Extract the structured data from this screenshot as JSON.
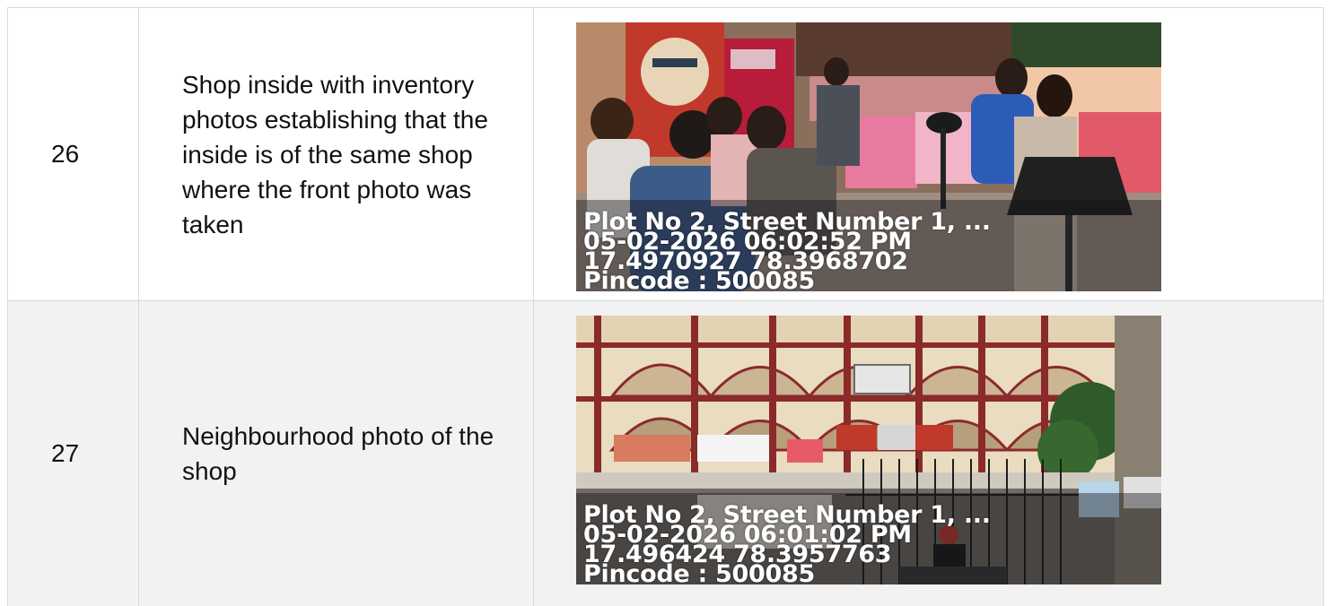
{
  "rows": [
    {
      "number": "26",
      "description": "Shop inside with inventory photos establishing that the inside is of the same shop where the front photo was taken",
      "photo": {
        "scene": "shop-interior",
        "stamp": {
          "address": "Plot No 2, Street Number 1, ...",
          "datetime": "05-02-2026 06:02:52 PM",
          "coords": "17.4970927 78.3968702",
          "pincode": "Pincode : 500085"
        }
      }
    },
    {
      "number": "27",
      "description": "Neighbourhood photo of the shop",
      "photo": {
        "scene": "street-building",
        "stamp": {
          "address": "Plot No 2, Street Number 1, ...",
          "datetime": "05-02-2026 06:01:02 PM",
          "coords": "17.496424 78.3957763",
          "pincode": "Pincode : 500085"
        }
      }
    }
  ],
  "colors": {
    "border": "#d9d9d9",
    "alt_row": "#f2f2f2"
  }
}
